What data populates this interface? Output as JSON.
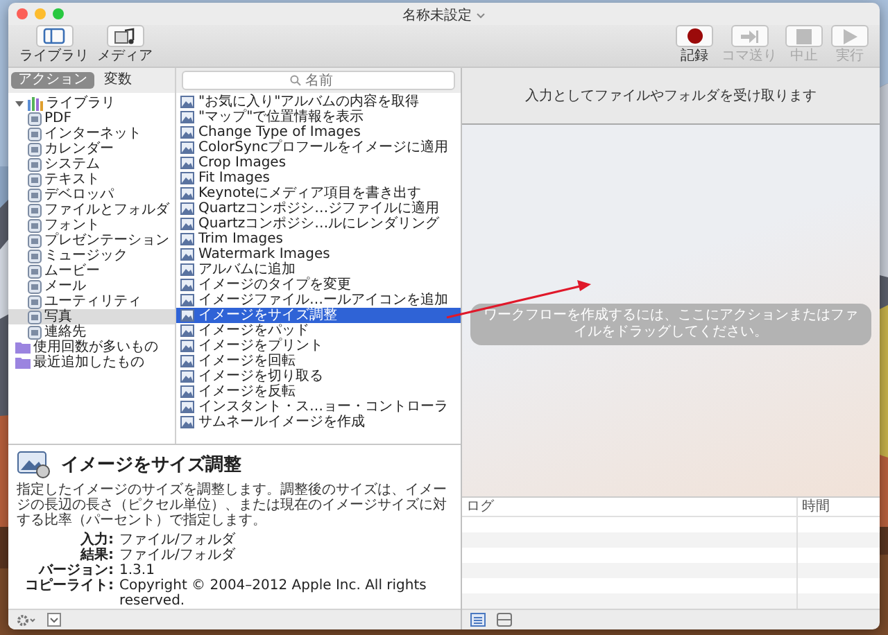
{
  "window": {
    "title": "名称未設定"
  },
  "toolbar": {
    "left": [
      {
        "kind": "library",
        "label": "ライブラリ",
        "disabled": false
      },
      {
        "kind": "media",
        "label": "メディア",
        "disabled": false
      }
    ],
    "right": [
      {
        "kind": "record",
        "label": "記録",
        "disabled": false
      },
      {
        "kind": "step",
        "label": "コマ送り",
        "disabled": true
      },
      {
        "kind": "stop",
        "label": "中止",
        "disabled": true
      },
      {
        "kind": "run",
        "label": "実行",
        "disabled": true
      }
    ]
  },
  "tabs": [
    {
      "label": "アクション",
      "selected": true
    },
    {
      "label": "変数",
      "selected": false
    }
  ],
  "search": {
    "placeholder": "名前"
  },
  "library": [
    {
      "label": "ライブラリ",
      "expanded": true,
      "selected": false,
      "children": [
        {
          "label": "PDF",
          "selected": false
        },
        {
          "label": "インターネット",
          "selected": false
        },
        {
          "label": "カレンダー",
          "selected": false
        },
        {
          "label": "システム",
          "selected": false
        },
        {
          "label": "テキスト",
          "selected": false
        },
        {
          "label": "デベロッパ",
          "selected": false
        },
        {
          "label": "ファイルとフォルダ",
          "selected": false
        },
        {
          "label": "フォント",
          "selected": false
        },
        {
          "label": "プレゼンテーション",
          "selected": false
        },
        {
          "label": "ミュージック",
          "selected": false
        },
        {
          "label": "ムービー",
          "selected": false
        },
        {
          "label": "メール",
          "selected": false
        },
        {
          "label": "ユーティリティ",
          "selected": false
        },
        {
          "label": "写真",
          "selected": true
        },
        {
          "label": "連絡先",
          "selected": false
        }
      ]
    },
    {
      "label": "使用回数が多いもの",
      "selected": false
    },
    {
      "label": "最近追加したもの",
      "selected": false
    }
  ],
  "actions": [
    {
      "label": "\"お気に入り\"アルバムの内容を取得",
      "selected": false
    },
    {
      "label": "\"マップ\"で位置情報を表示",
      "selected": false
    },
    {
      "label": "Change Type of Images",
      "selected": false
    },
    {
      "label": "ColorSyncプロフールをイメージに適用",
      "selected": false
    },
    {
      "label": "Crop Images",
      "selected": false
    },
    {
      "label": "Fit Images",
      "selected": false
    },
    {
      "label": "Keynoteにメディア項目を書き出す",
      "selected": false
    },
    {
      "label": "Quartzコンポジシ…ジファイルに適用",
      "selected": false
    },
    {
      "label": "Quartzコンポジシ…ルにレンダリング",
      "selected": false
    },
    {
      "label": "Trim Images",
      "selected": false
    },
    {
      "label": "Watermark Images",
      "selected": false
    },
    {
      "label": "アルバムに追加",
      "selected": false
    },
    {
      "label": "イメージのタイプを変更",
      "selected": false
    },
    {
      "label": "イメージファイル…ールアイコンを追加",
      "selected": false
    },
    {
      "label": "イメージをサイズ調整",
      "selected": true
    },
    {
      "label": "イメージをパッド",
      "selected": false
    },
    {
      "label": "イメージをプリント",
      "selected": false
    },
    {
      "label": "イメージを回転",
      "selected": false
    },
    {
      "label": "イメージを切り取る",
      "selected": false
    },
    {
      "label": "イメージを反転",
      "selected": false
    },
    {
      "label": "インスタント・ス…ョー・コントローラ",
      "selected": false
    },
    {
      "label": "サムネールイメージを作成",
      "selected": false
    }
  ],
  "description": {
    "title": "イメージをサイズ調整",
    "text": "指定したイメージのサイズを調整します。調整後のサイズは、イメージの長辺の長さ（ピクセル単位）、または現在のイメージサイズに対する比率（パーセント）で指定します。",
    "fields": [
      {
        "label": "入力:",
        "value": "ファイル/フォルダ"
      },
      {
        "label": "結果:",
        "value": "ファイル/フォルダ"
      },
      {
        "label": "バージョン:",
        "value": "1.3.1"
      },
      {
        "label": "コピーライト:",
        "value": "Copyright © 2004–2012 Apple Inc.  All rights reserved."
      }
    ]
  },
  "workflow": {
    "input_label": "入力としてファイルやフォルダを受け取ります",
    "hint": "ワークフローを作成するには、ここにアクションまたはファイルをドラッグしてください。"
  },
  "log": {
    "columns": [
      "ログ",
      "時間"
    ]
  }
}
